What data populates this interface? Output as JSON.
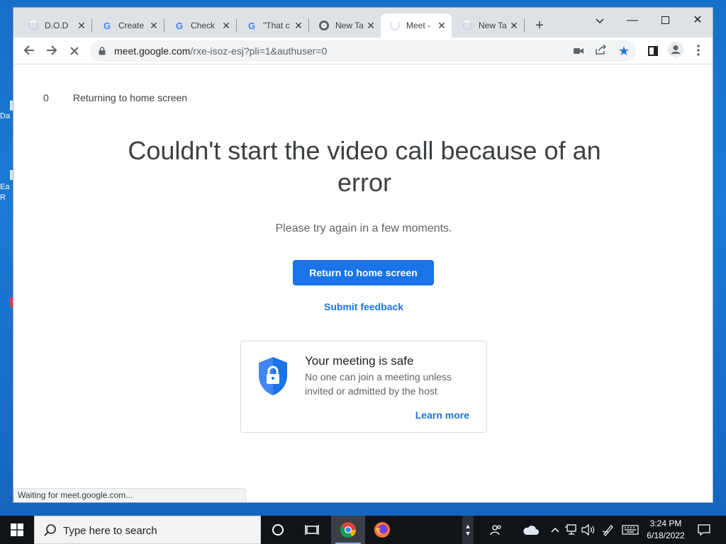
{
  "desktop": {
    "fragments": [
      "Da",
      "Ea",
      "R"
    ]
  },
  "browser": {
    "tabs": [
      {
        "title": "D.O.D",
        "favicon": "spinner-icon",
        "active": false
      },
      {
        "title": "Create",
        "favicon": "google-icon",
        "active": false
      },
      {
        "title": "Check",
        "favicon": "google-icon",
        "active": false
      },
      {
        "title": "\"That c",
        "favicon": "google-icon",
        "active": false
      },
      {
        "title": "New Ta",
        "favicon": "chrome-icon",
        "active": false
      },
      {
        "title": "Meet -",
        "favicon": "spinner-icon",
        "active": true
      },
      {
        "title": "New Ta",
        "favicon": "spinner-icon",
        "active": false
      }
    ],
    "url_host": "meet.google.com",
    "url_path": "/rxe-isoz-esj?pli=1&authuser=0",
    "status_text": "Waiting for meet.google.com..."
  },
  "page": {
    "countdown": "0",
    "countdown_label": "Returning to home screen",
    "headline": "Couldn't start the video call because of an error",
    "subline": "Please try again in a few moments.",
    "primary_button": "Return to home screen",
    "feedback_link": "Submit feedback",
    "safe_card": {
      "title": "Your meeting is safe",
      "description": "No one can join a meeting unless invited or admitted by the host",
      "learn_more": "Learn more"
    }
  },
  "taskbar": {
    "search_placeholder": "Type here to search",
    "time": "3:24 PM",
    "date": "6/18/2022"
  },
  "colors": {
    "accent": "#1a73e8",
    "shield": "#4285f4",
    "taskbar": "#101418",
    "desktop": "#1670c9"
  }
}
